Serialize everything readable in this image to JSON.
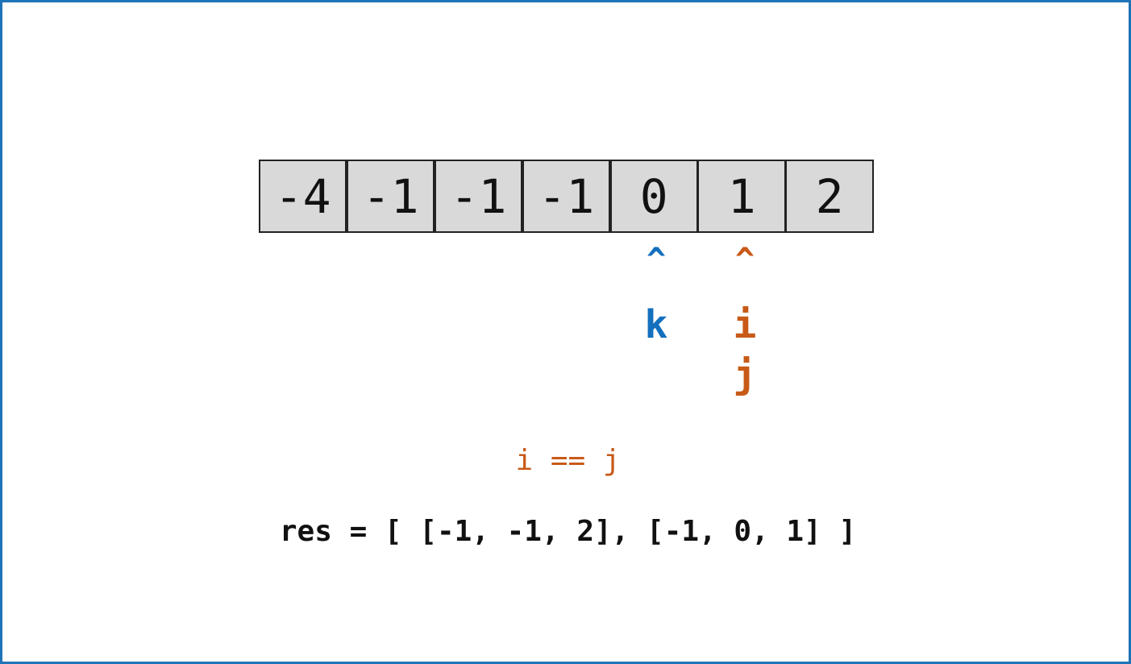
{
  "array": {
    "cells": [
      "-4",
      "-1",
      "-1",
      "-1",
      "0",
      "1",
      "2"
    ]
  },
  "pointers": {
    "k": {
      "caret": "^",
      "label": "k",
      "index": 4,
      "color": "#1470be"
    },
    "ij": {
      "caret": "^",
      "labels": [
        "i",
        "j"
      ],
      "index": 5,
      "color": "#c85a18"
    }
  },
  "condition": "i == j",
  "result": "res = [ [-1, -1, 2], [-1, 0, 1] ]"
}
